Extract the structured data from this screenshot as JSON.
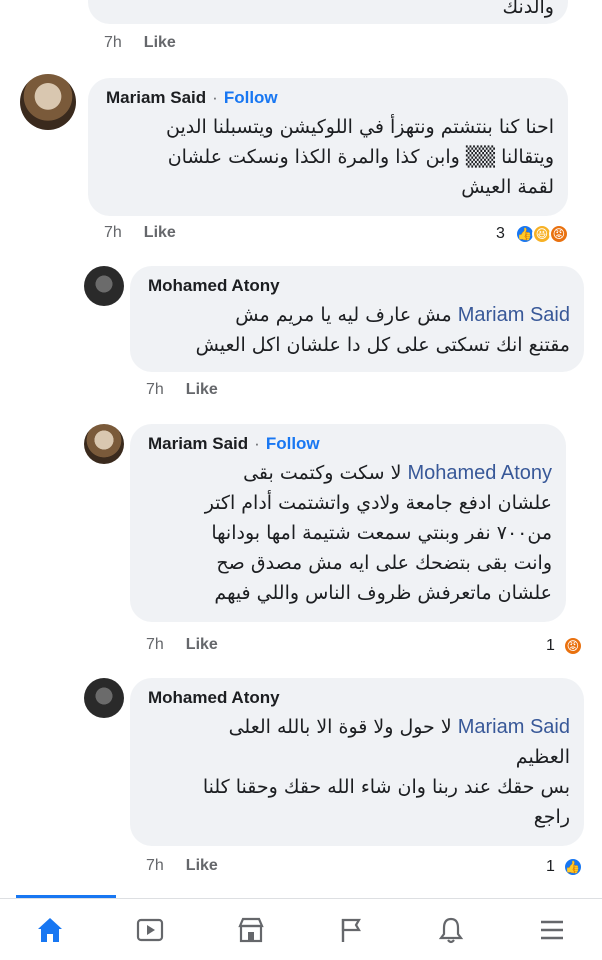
{
  "top_comment": {
    "text_fragment": "والدنك",
    "time": "7h",
    "like_label": "Like"
  },
  "comments": [
    {
      "author": "Mariam Said",
      "follow_label": "Follow",
      "separator": "·",
      "lines": [
        "احنا كنا بنتشتم ونتهزأ في اللوكيشن ويتسبلنا الدين",
        "ويتقالنا ▒▒ وابن كذا والمرة الكذا ونسكت علشان",
        "لقمة العيش"
      ],
      "time": "7h",
      "like_label": "Like",
      "reaction_count": "3",
      "reactions": [
        "like",
        "haha",
        "angry"
      ]
    },
    {
      "author": "Mohamed Atony",
      "mention": "Mariam Said",
      "lines": [
        "مش عارف ليه يا مريم مش",
        "مقتنع انك تسكتى على كل دا علشان اكل العيش"
      ],
      "time": "7h",
      "like_label": "Like"
    },
    {
      "author": "Mariam Said",
      "follow_label": "Follow",
      "separator": "·",
      "mention": "Mohamed Atony",
      "lines": [
        "لا سكت وكتمت بقى",
        "علشان ادفع جامعة ولادي واتشتمت أدام اكتر",
        "من٧٠٠ نفر وبنتي سمعت شتيمة امها بودانها",
        "وانت بقى بتضحك على ايه مش مصدق صح",
        "علشان ماتعرفش ظروف الناس واللي فيهم"
      ],
      "time": "7h",
      "like_label": "Like",
      "reaction_count": "1",
      "reactions": [
        "angry"
      ]
    },
    {
      "author": "Mohamed Atony",
      "mention": "Mariam Said",
      "lines": [
        "لا حول ولا قوة الا بالله العلى",
        "العظيم",
        "بس حقك عند ربنا وان شاء الله حقك وحقنا كلنا",
        "راجع"
      ],
      "time": "7h",
      "like_label": "Like",
      "reaction_count": "1",
      "reactions": [
        "like"
      ]
    }
  ],
  "nav": {
    "items": [
      "home-icon",
      "video-icon",
      "marketplace-icon",
      "pages-flag-icon",
      "notifications-bell-icon",
      "menu-icon"
    ],
    "active": "home-icon",
    "accent": "#1877f2",
    "inactive_color": "#65676b"
  }
}
